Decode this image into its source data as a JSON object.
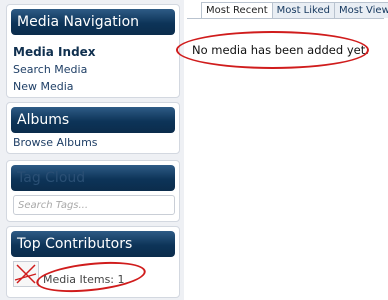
{
  "sidebar": {
    "navigation": {
      "title": "Media Navigation",
      "links": [
        "Media Index",
        "Search Media",
        "New Media"
      ]
    },
    "albums": {
      "title": "Albums",
      "links": [
        "Browse Albums"
      ]
    },
    "tags": {
      "title": "Tag Cloud",
      "search_placeholder": "Search Tags..."
    },
    "contributors": {
      "title": "Top Contributors",
      "media_items_text": "Media Items: 1"
    }
  },
  "main": {
    "tabs": [
      "Most Recent",
      "Most Liked",
      "Most Viewed"
    ],
    "active_tab": "Most Recent",
    "empty_message": "No media has been added yet."
  },
  "colors": {
    "header_gradient_top": "#2e5b86",
    "header_gradient_bottom": "#0b2c4c",
    "annotation_red": "#d01c1c"
  }
}
